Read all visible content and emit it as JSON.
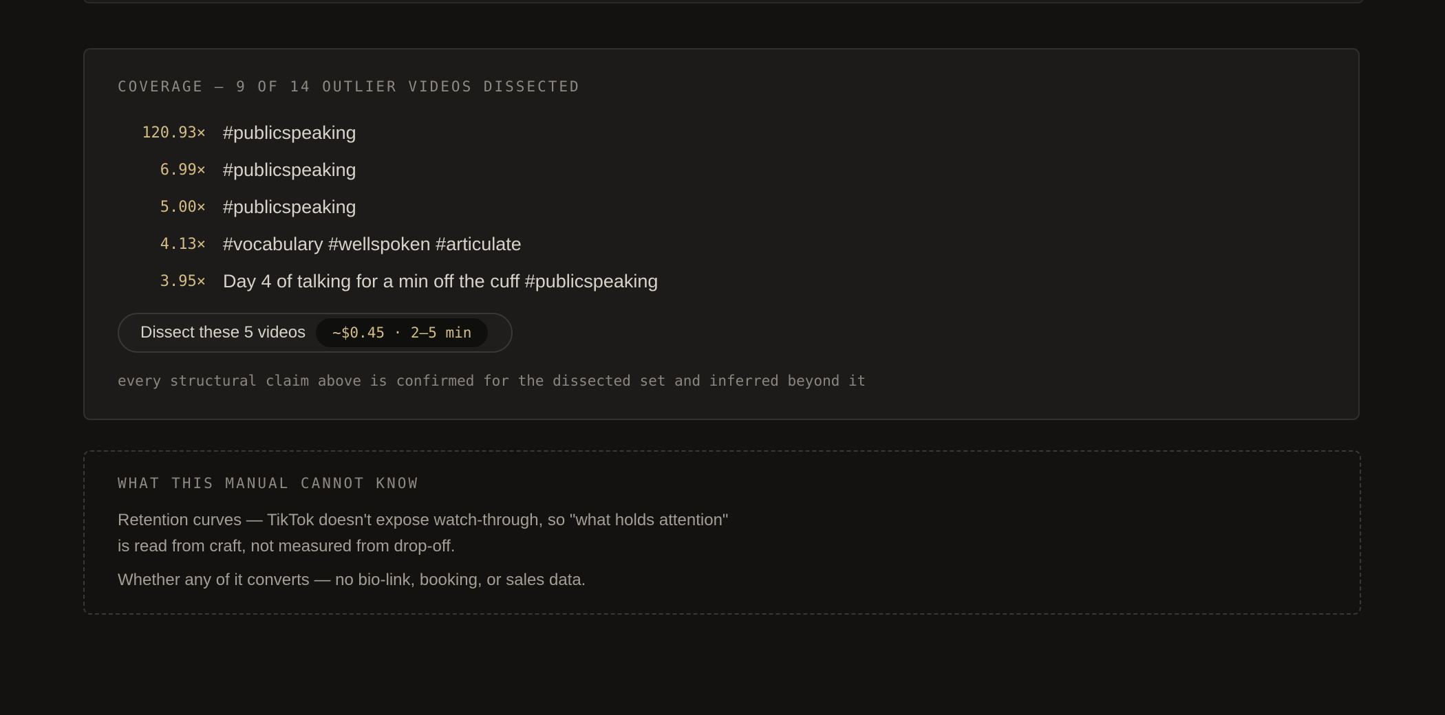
{
  "coverage": {
    "label": "COVERAGE — 9 OF 14 OUTLIER VIDEOS DISSECTED",
    "videos": [
      {
        "multiplier": "120.93×",
        "title": "#publicspeaking"
      },
      {
        "multiplier": "6.99×",
        "title": "#publicspeaking"
      },
      {
        "multiplier": "5.00×",
        "title": "#publicspeaking"
      },
      {
        "multiplier": "4.13×",
        "title": "#vocabulary #wellspoken #articulate"
      },
      {
        "multiplier": "3.95×",
        "title": "Day 4 of talking for a min off the cuff #publicspeaking"
      }
    ],
    "dissect_button": {
      "label": "Dissect these 5 videos",
      "cost": "~$0.45 · 2–5 min"
    },
    "footnote": "every structural claim above is confirmed for the dissected set and inferred beyond it"
  },
  "limits": {
    "label": "WHAT THIS MANUAL CANNOT KNOW",
    "items": [
      "Retention curves — TikTok doesn't expose watch-through, so \"what holds attention\" is read from craft, not measured from drop-off.",
      "Whether any of it converts — no bio-link, booking, or sales data."
    ]
  },
  "colors": {
    "background": "#131211",
    "card": "#1c1b1a",
    "accent": "#d3bd83"
  }
}
